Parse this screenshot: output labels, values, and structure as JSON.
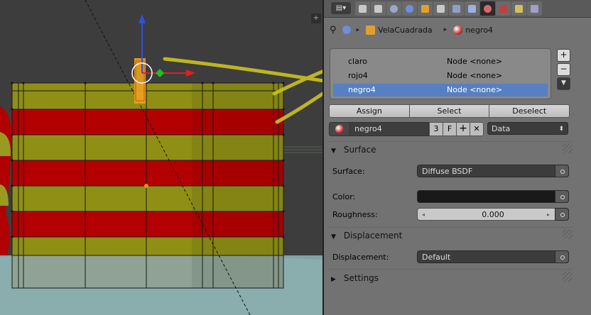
{
  "viewport": {
    "corner_glyph": "+"
  },
  "header": {
    "menu_glyph": "▤▾",
    "tabs": [
      {
        "name": "render-icon",
        "color": "#c8c8c8"
      },
      {
        "name": "render-layers-icon",
        "color": "#c8c8c8"
      },
      {
        "name": "scene-icon",
        "color": "#9aa7c8"
      },
      {
        "name": "world-icon",
        "color": "#6e8fd8"
      },
      {
        "name": "object-icon",
        "color": "#e0a030"
      },
      {
        "name": "constraints-icon",
        "color": "#c8c8c8"
      },
      {
        "name": "modifiers-icon",
        "color": "#8fa0c8"
      },
      {
        "name": "data-icon",
        "color": "#9ab0e8"
      },
      {
        "name": "material-icon",
        "color": "#d86868",
        "active": true
      },
      {
        "name": "texture-icon",
        "color": "#c04040"
      },
      {
        "name": "particles-icon",
        "color": "#d0c060"
      },
      {
        "name": "physics-icon",
        "color": "#a0a0c8"
      }
    ]
  },
  "breadcrumb": {
    "object": "VelaCuadrada",
    "material": "negro4"
  },
  "material_slots": [
    {
      "name": "claro",
      "node": "Node <none>",
      "selected": false
    },
    {
      "name": "rojo4",
      "node": "Node <none>",
      "selected": false
    },
    {
      "name": "negro4",
      "node": "Node <none>",
      "selected": true
    }
  ],
  "slot_buttons": {
    "add": "+",
    "remove": "−",
    "menu": "▼"
  },
  "actions": {
    "assign": "Assign",
    "select": "Select",
    "deselect": "Deselect"
  },
  "material": {
    "name": "negro4",
    "users": "3",
    "fake_user": "F",
    "add": "+",
    "unlink": "✕",
    "link_mode": "Data",
    "link_arrow": "⬍"
  },
  "surface": {
    "title": "Surface",
    "surface_label": "Surface:",
    "surface_value": "Diffuse BSDF",
    "color_label": "Color:",
    "color_value": "#191919",
    "roughness_label": "Roughness:",
    "roughness_value": "0.000"
  },
  "displacement": {
    "title": "Displacement",
    "label": "Displacement:",
    "value": "Default"
  },
  "settings": {
    "title": "Settings"
  },
  "arrows": {
    "left": "◂",
    "right": "▸",
    "expanded": "▼",
    "collapsed": "▶"
  }
}
